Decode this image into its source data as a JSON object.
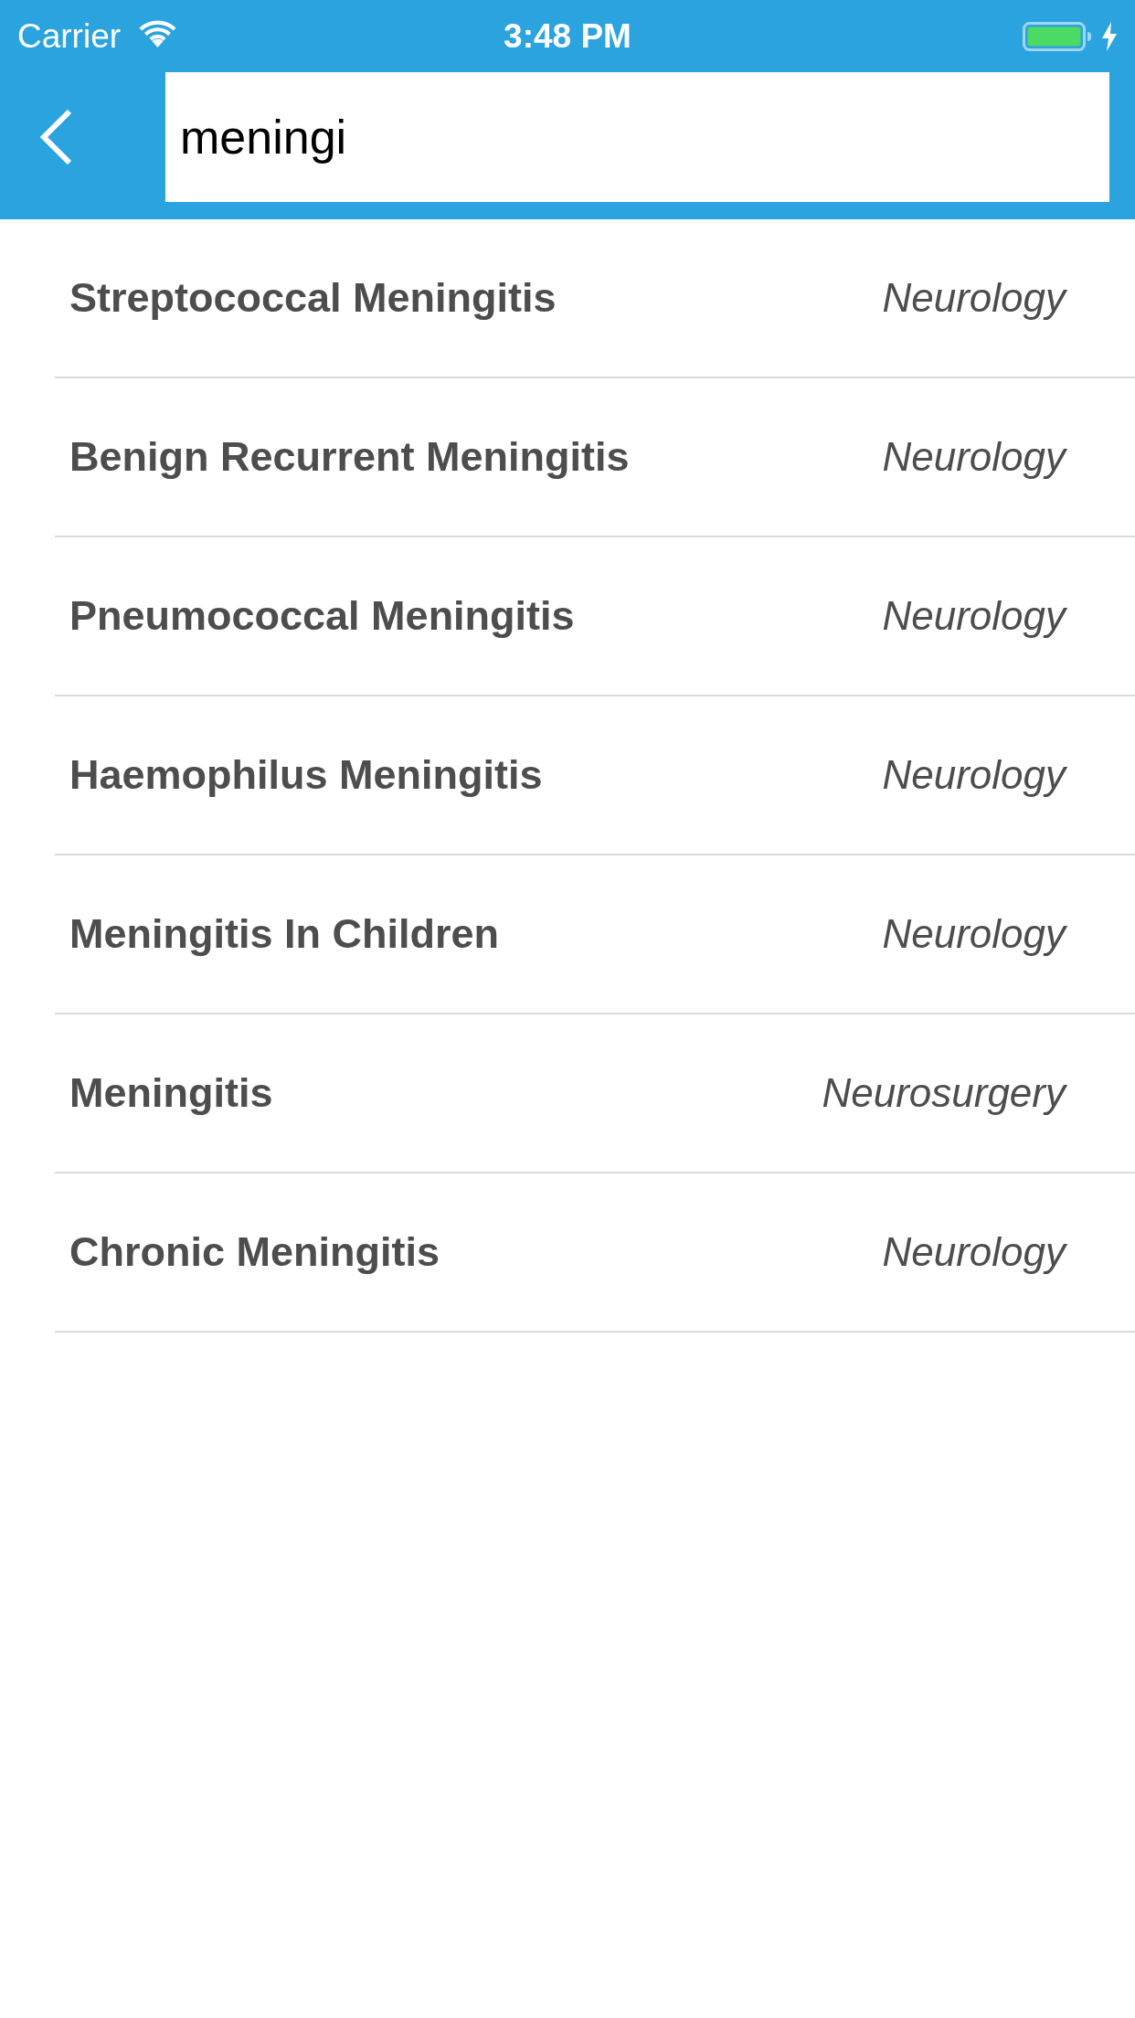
{
  "status_bar": {
    "carrier": "Carrier",
    "time": "3:48 PM",
    "charging": true
  },
  "header": {
    "search": {
      "value": "meningi"
    }
  },
  "results": [
    {
      "title": "Streptococcal Meningitis",
      "specialty": "Neurology"
    },
    {
      "title": "Benign Recurrent Meningitis",
      "specialty": "Neurology"
    },
    {
      "title": "Pneumococcal Meningitis",
      "specialty": "Neurology"
    },
    {
      "title": "Haemophilus Meningitis",
      "specialty": "Neurology"
    },
    {
      "title": "Meningitis In Children",
      "specialty": "Neurology"
    },
    {
      "title": "Meningitis",
      "specialty": "Neurosurgery"
    },
    {
      "title": "Chronic Meningitis",
      "specialty": "Neurology"
    }
  ]
}
